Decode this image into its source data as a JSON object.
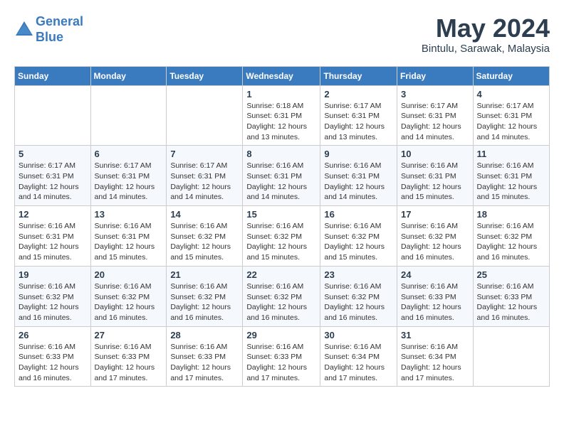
{
  "logo": {
    "line1": "General",
    "line2": "Blue"
  },
  "title": "May 2024",
  "location": "Bintulu, Sarawak, Malaysia",
  "weekdays": [
    "Sunday",
    "Monday",
    "Tuesday",
    "Wednesday",
    "Thursday",
    "Friday",
    "Saturday"
  ],
  "weeks": [
    [
      {
        "day": "",
        "info": ""
      },
      {
        "day": "",
        "info": ""
      },
      {
        "day": "",
        "info": ""
      },
      {
        "day": "1",
        "info": "Sunrise: 6:18 AM\nSunset: 6:31 PM\nDaylight: 12 hours\nand 13 minutes."
      },
      {
        "day": "2",
        "info": "Sunrise: 6:17 AM\nSunset: 6:31 PM\nDaylight: 12 hours\nand 13 minutes."
      },
      {
        "day": "3",
        "info": "Sunrise: 6:17 AM\nSunset: 6:31 PM\nDaylight: 12 hours\nand 14 minutes."
      },
      {
        "day": "4",
        "info": "Sunrise: 6:17 AM\nSunset: 6:31 PM\nDaylight: 12 hours\nand 14 minutes."
      }
    ],
    [
      {
        "day": "5",
        "info": "Sunrise: 6:17 AM\nSunset: 6:31 PM\nDaylight: 12 hours\nand 14 minutes."
      },
      {
        "day": "6",
        "info": "Sunrise: 6:17 AM\nSunset: 6:31 PM\nDaylight: 12 hours\nand 14 minutes."
      },
      {
        "day": "7",
        "info": "Sunrise: 6:17 AM\nSunset: 6:31 PM\nDaylight: 12 hours\nand 14 minutes."
      },
      {
        "day": "8",
        "info": "Sunrise: 6:16 AM\nSunset: 6:31 PM\nDaylight: 12 hours\nand 14 minutes."
      },
      {
        "day": "9",
        "info": "Sunrise: 6:16 AM\nSunset: 6:31 PM\nDaylight: 12 hours\nand 14 minutes."
      },
      {
        "day": "10",
        "info": "Sunrise: 6:16 AM\nSunset: 6:31 PM\nDaylight: 12 hours\nand 15 minutes."
      },
      {
        "day": "11",
        "info": "Sunrise: 6:16 AM\nSunset: 6:31 PM\nDaylight: 12 hours\nand 15 minutes."
      }
    ],
    [
      {
        "day": "12",
        "info": "Sunrise: 6:16 AM\nSunset: 6:31 PM\nDaylight: 12 hours\nand 15 minutes."
      },
      {
        "day": "13",
        "info": "Sunrise: 6:16 AM\nSunset: 6:31 PM\nDaylight: 12 hours\nand 15 minutes."
      },
      {
        "day": "14",
        "info": "Sunrise: 6:16 AM\nSunset: 6:32 PM\nDaylight: 12 hours\nand 15 minutes."
      },
      {
        "day": "15",
        "info": "Sunrise: 6:16 AM\nSunset: 6:32 PM\nDaylight: 12 hours\nand 15 minutes."
      },
      {
        "day": "16",
        "info": "Sunrise: 6:16 AM\nSunset: 6:32 PM\nDaylight: 12 hours\nand 15 minutes."
      },
      {
        "day": "17",
        "info": "Sunrise: 6:16 AM\nSunset: 6:32 PM\nDaylight: 12 hours\nand 16 minutes."
      },
      {
        "day": "18",
        "info": "Sunrise: 6:16 AM\nSunset: 6:32 PM\nDaylight: 12 hours\nand 16 minutes."
      }
    ],
    [
      {
        "day": "19",
        "info": "Sunrise: 6:16 AM\nSunset: 6:32 PM\nDaylight: 12 hours\nand 16 minutes."
      },
      {
        "day": "20",
        "info": "Sunrise: 6:16 AM\nSunset: 6:32 PM\nDaylight: 12 hours\nand 16 minutes."
      },
      {
        "day": "21",
        "info": "Sunrise: 6:16 AM\nSunset: 6:32 PM\nDaylight: 12 hours\nand 16 minutes."
      },
      {
        "day": "22",
        "info": "Sunrise: 6:16 AM\nSunset: 6:32 PM\nDaylight: 12 hours\nand 16 minutes."
      },
      {
        "day": "23",
        "info": "Sunrise: 6:16 AM\nSunset: 6:32 PM\nDaylight: 12 hours\nand 16 minutes."
      },
      {
        "day": "24",
        "info": "Sunrise: 6:16 AM\nSunset: 6:33 PM\nDaylight: 12 hours\nand 16 minutes."
      },
      {
        "day": "25",
        "info": "Sunrise: 6:16 AM\nSunset: 6:33 PM\nDaylight: 12 hours\nand 16 minutes."
      }
    ],
    [
      {
        "day": "26",
        "info": "Sunrise: 6:16 AM\nSunset: 6:33 PM\nDaylight: 12 hours\nand 16 minutes."
      },
      {
        "day": "27",
        "info": "Sunrise: 6:16 AM\nSunset: 6:33 PM\nDaylight: 12 hours\nand 17 minutes."
      },
      {
        "day": "28",
        "info": "Sunrise: 6:16 AM\nSunset: 6:33 PM\nDaylight: 12 hours\nand 17 minutes."
      },
      {
        "day": "29",
        "info": "Sunrise: 6:16 AM\nSunset: 6:33 PM\nDaylight: 12 hours\nand 17 minutes."
      },
      {
        "day": "30",
        "info": "Sunrise: 6:16 AM\nSunset: 6:34 PM\nDaylight: 12 hours\nand 17 minutes."
      },
      {
        "day": "31",
        "info": "Sunrise: 6:16 AM\nSunset: 6:34 PM\nDaylight: 12 hours\nand 17 minutes."
      },
      {
        "day": "",
        "info": ""
      }
    ]
  ]
}
